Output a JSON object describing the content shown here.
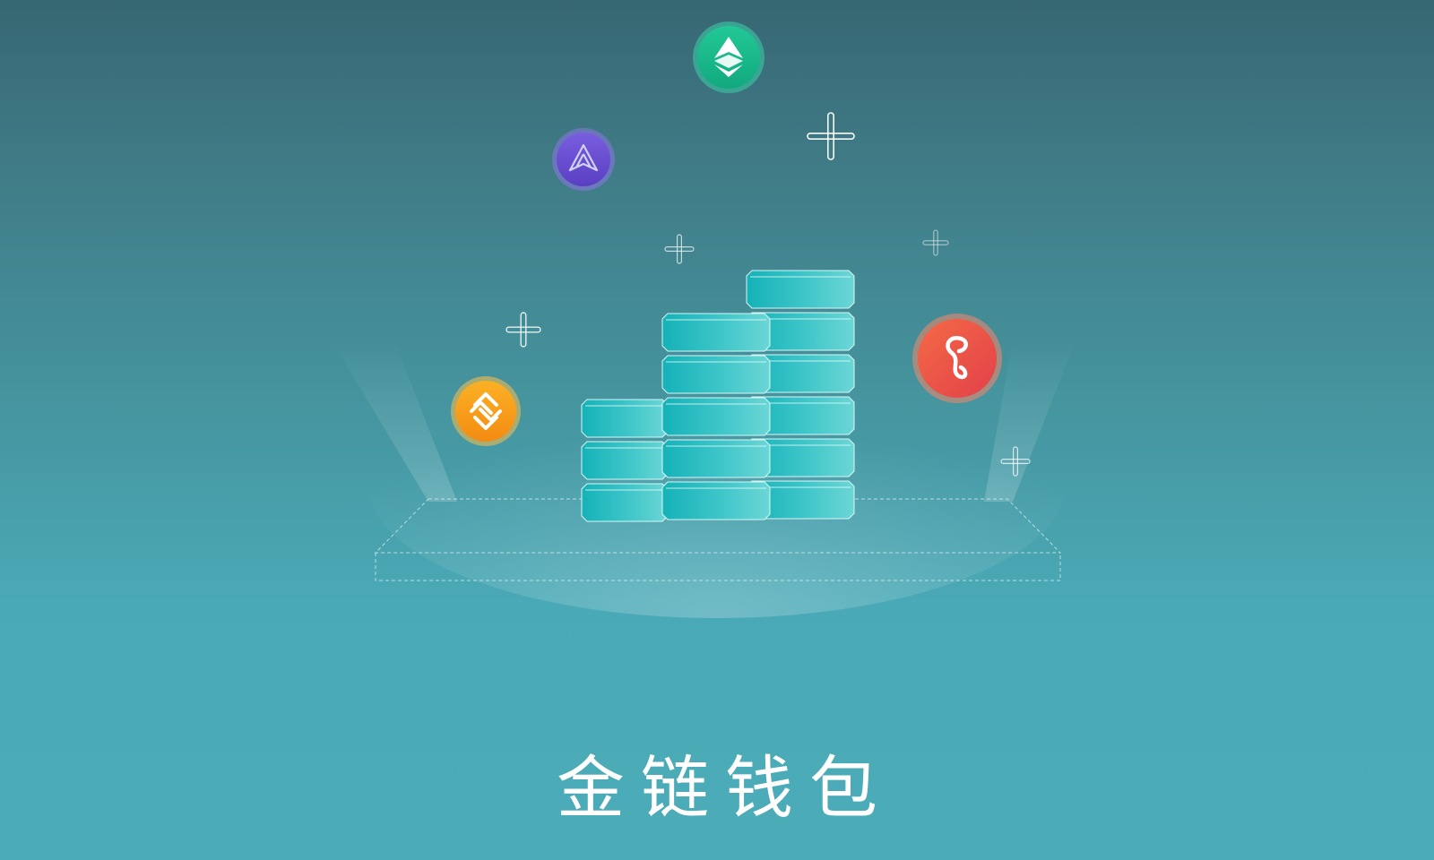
{
  "app": {
    "title": "金链钱包"
  },
  "colors": {
    "background_top": "#366773",
    "background_bottom": "#4bacb8",
    "coin_stack": "#1fb7bd",
    "etc_coin": "#19b98f",
    "violet_coin": "#6a4fd0",
    "orange_coin": "#f79a1a",
    "red_coin": "#ee5444"
  },
  "icons": {
    "etc_coin": "ethereum-classic-coin-icon",
    "violet_coin": "bird-token-coin-icon",
    "orange_coin": "bancor-token-coin-icon",
    "red_coin": "link-token-coin-icon",
    "sparkle": "sparkle-cross-icon"
  }
}
